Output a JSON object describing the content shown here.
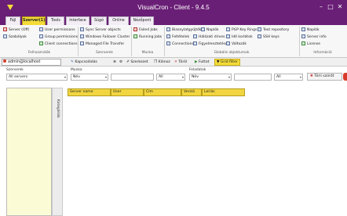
{
  "window": {
    "title": "VisualCron - Client - 9.4.5",
    "controls": [
      "–",
      "□",
      "✕"
    ]
  },
  "tabs": [
    {
      "label": "Fájl",
      "active": false
    },
    {
      "label": "Szerver(1)",
      "active": true
    },
    {
      "label": "Tools",
      "active": false
    },
    {
      "label": "Interface",
      "active": false
    },
    {
      "label": "Súgó",
      "active": false
    },
    {
      "label": "Online",
      "active": false
    },
    {
      "label": "Nézőpont",
      "active": false
    }
  ],
  "ribbon": {
    "groups": [
      {
        "name": "Felhasználók",
        "items": [
          "Server (Off)",
          "Szabályok",
          "User permissions",
          "Group permissions",
          "Client connections"
        ]
      },
      {
        "name": "Szerverek",
        "items": [
          "Sync Server objects",
          "Windows Failover Cluster",
          "Managed File Transfer"
        ]
      },
      {
        "name": "Munka",
        "items": [
          "Failed Jobs",
          "Running Jobs"
        ]
      },
      {
        "name": "Globális objektumok",
        "items": [
          "Bizonylatgyűjtők",
          "Naplók",
          "Feltételek",
          "Hálózati drives",
          "Connections",
          "Figyelmeztetések",
          "PGP Key Rings",
          "Idő korlátok",
          "Változók",
          "Text repository",
          "SSH keys"
        ]
      },
      {
        "name": "Információ",
        "items": [
          "Naplók",
          "Server info",
          "License"
        ]
      }
    ]
  },
  "toolbar": {
    "user": "admin@localhost",
    "items": [
      "Kapcsolódás",
      "Szerkezet",
      "Klónoz",
      "Töröl",
      "Futtat"
    ],
    "grid_filter": "Grid filter"
  },
  "filters": {
    "server": {
      "label": "Szerverek",
      "value": "All servers"
    },
    "job": {
      "label": "Munka",
      "value": "Név",
      "value2": "All"
    },
    "task": {
      "label": "Feladatok",
      "value": "Név",
      "value2": "All"
    },
    "clear_button": "Törli szűrőt"
  },
  "sidebar": {
    "vertical_label": "Kategóriák"
  },
  "grid": {
    "columns": [
      "Server name",
      "User",
      "Cím",
      "Verzió",
      "Leírás"
    ]
  }
}
